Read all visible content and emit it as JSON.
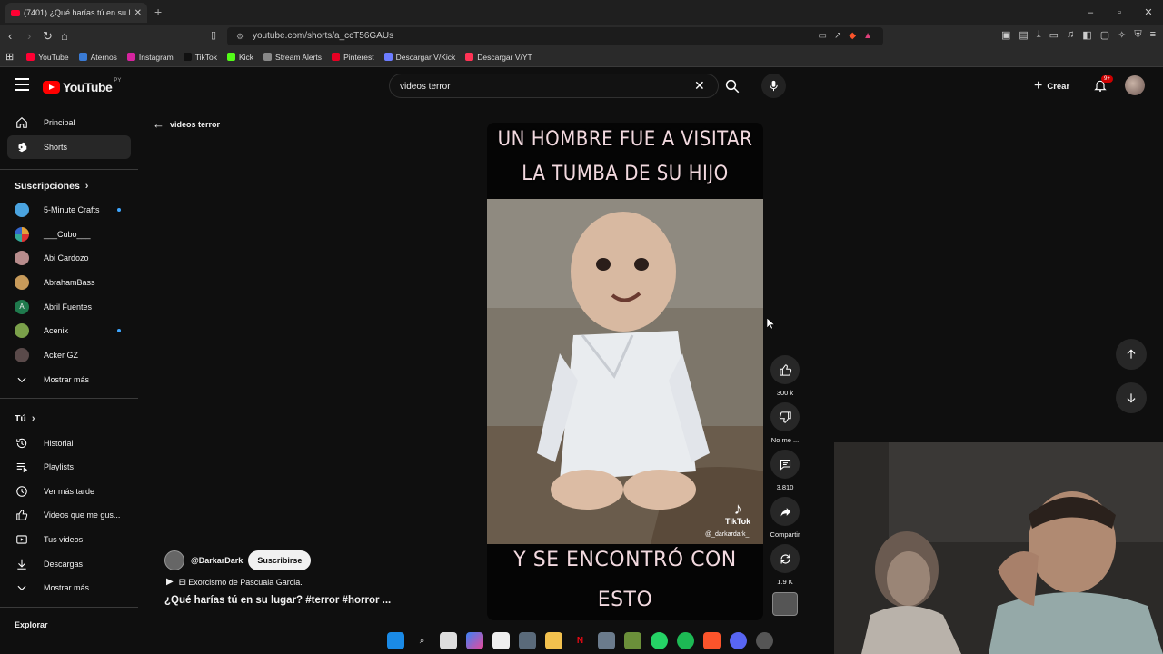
{
  "browser": {
    "tab_title": "(7401) ¿Qué harías tú en su lu",
    "url": "youtube.com/shorts/a_ccT56GAUs",
    "bookmarks": [
      {
        "label": "YouTube",
        "color": "#ff0033"
      },
      {
        "label": "Aternos",
        "color": "#3a7bd5"
      },
      {
        "label": "Instagram",
        "color": "#d6249f"
      },
      {
        "label": "TikTok",
        "color": "#111111"
      },
      {
        "label": "Kick",
        "color": "#53fc18"
      },
      {
        "label": "Stream Alerts",
        "color": "#888888"
      },
      {
        "label": "Pinterest",
        "color": "#e60023"
      },
      {
        "label": "Descargar V/Kick",
        "color": "#6c7cff"
      },
      {
        "label": "Descargar V/YT",
        "color": "#ff3355"
      }
    ]
  },
  "header": {
    "logo_text": "YouTube",
    "logo_country": "PY",
    "search_value": "videos terror",
    "create_label": "Crear",
    "notif_badge": "9+"
  },
  "sidebar": {
    "nav": [
      {
        "label": "Principal",
        "icon": "home-icon"
      },
      {
        "label": "Shorts",
        "icon": "shorts-icon",
        "active": true
      }
    ],
    "subs_heading": "Suscripciones",
    "subscriptions": [
      {
        "label": "5-Minute Crafts",
        "color": "#4aa3df",
        "new": true
      },
      {
        "label": "___Cubo___",
        "color": "#e2a23b",
        "new": false
      },
      {
        "label": "Abi Cardozo",
        "color": "#b88c8c",
        "new": false
      },
      {
        "label": "AbrahamBass",
        "color": "#c79a5a",
        "new": false
      },
      {
        "label": "Abril Fuentes",
        "color": "#1f7a4d",
        "letter": "A",
        "new": false
      },
      {
        "label": "Acenix",
        "color": "#7aa04a",
        "new": true
      },
      {
        "label": "Acker GZ",
        "color": "#5a4a4a",
        "new": false
      }
    ],
    "subs_more": "Mostrar más",
    "you_heading": "Tú",
    "you_items": [
      {
        "label": "Historial",
        "icon": "history-icon"
      },
      {
        "label": "Playlists",
        "icon": "playlist-icon"
      },
      {
        "label": "Ver más tarde",
        "icon": "clock-icon"
      },
      {
        "label": "Videos que me gus...",
        "icon": "thumbs-up-icon"
      },
      {
        "label": "Tus videos",
        "icon": "video-icon"
      },
      {
        "label": "Descargas",
        "icon": "download-icon"
      }
    ],
    "you_more": "Mostrar más",
    "explore_heading": "Explorar"
  },
  "shorts": {
    "back_label": "videos terror",
    "caption_top": "UN HOMBRE FUE A VISITAR LA TUMBA DE SU HIJO",
    "caption_bottom": "Y SE ENCONTRÓ CON ESTO",
    "watermark": "TikTok",
    "watermark_user": "@_darkardark_",
    "likes": "300 k",
    "dislike_label": "No me ...",
    "comments": "3,810",
    "share_label": "Compartir",
    "remix_count": "1.9 K",
    "channel": "@DarkarDark",
    "subscribe_label": "Suscribirse",
    "music": "El Exorcismo de Pascuala Garcia.",
    "title": "¿Qué harías tú en su lugar? #terror #horror ..."
  }
}
